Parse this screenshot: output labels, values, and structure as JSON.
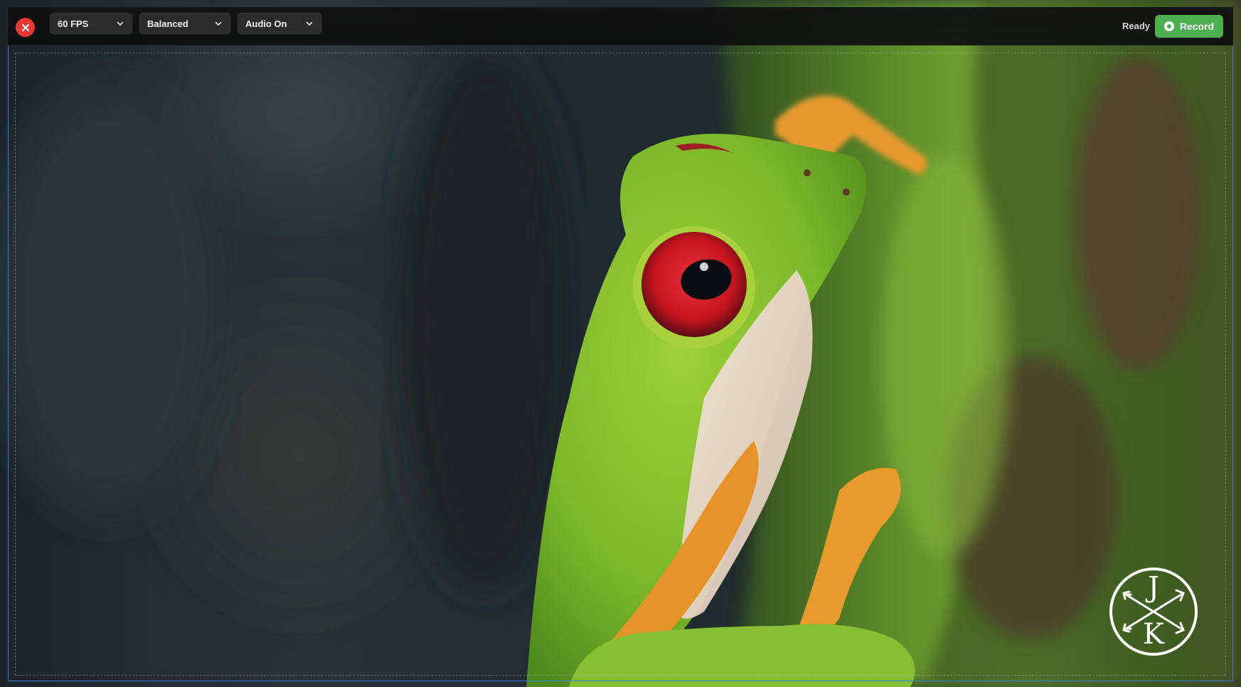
{
  "toolbar": {
    "close_icon": "close-icon",
    "fps": {
      "selected": "60 FPS"
    },
    "quality": {
      "selected": "Balanced"
    },
    "audio": {
      "selected": "Audio On"
    },
    "status": "Ready",
    "record_label": "Record"
  },
  "logo": {
    "top_letter": "J",
    "bottom_letter": "K"
  },
  "colors": {
    "close": "#e53935",
    "record": "#4caf50",
    "frame": "#3d7bdc",
    "toolbar": "#121212"
  }
}
